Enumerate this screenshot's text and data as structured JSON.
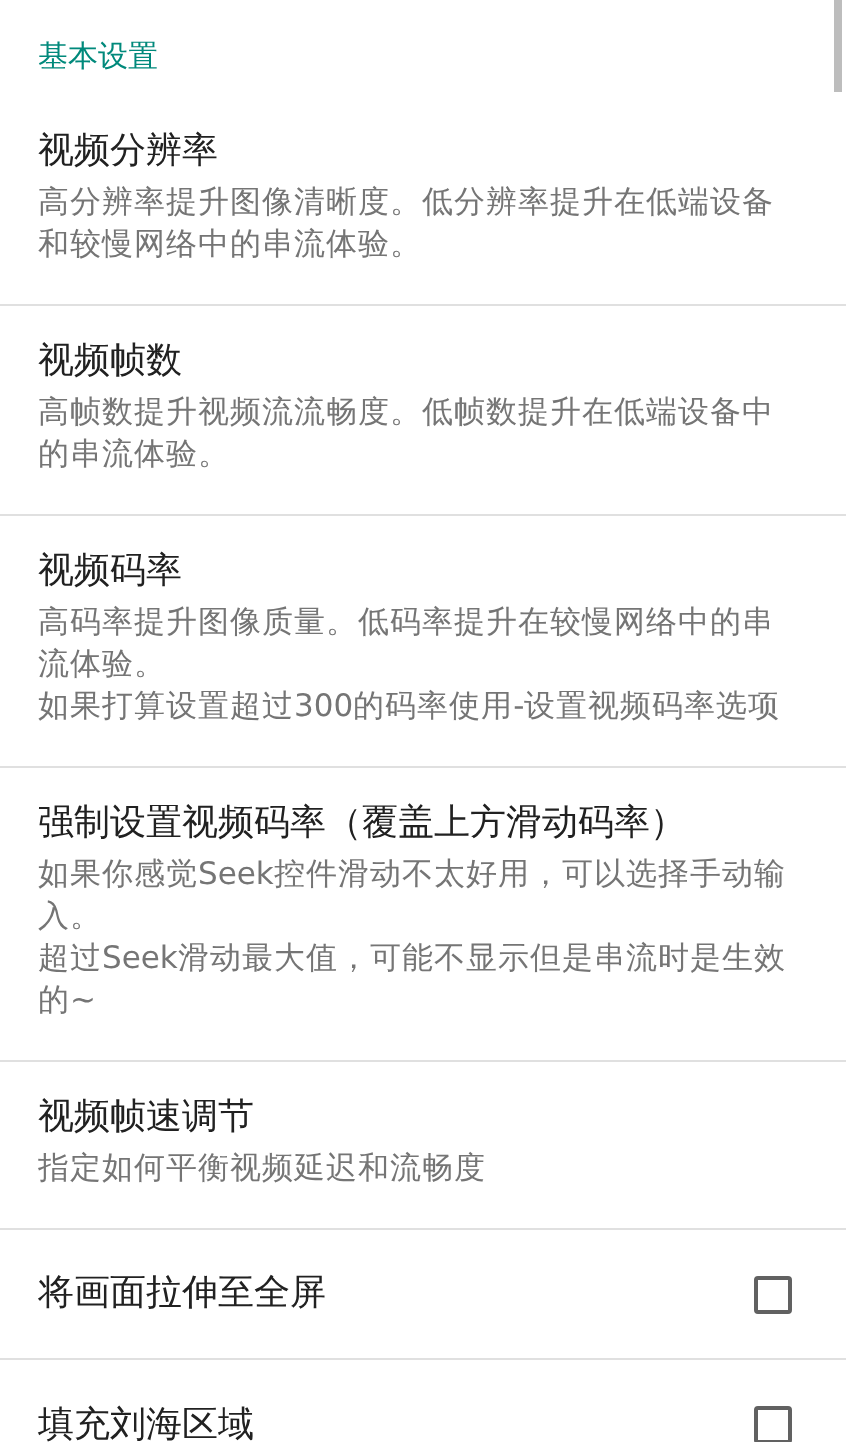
{
  "section_header": "基本设置",
  "items": [
    {
      "kind": "text",
      "title": "视频分辨率",
      "summary": [
        "高分辨率提升图像清晰度。低分辨率提升在低端设备和较慢网络中的串流体验。"
      ]
    },
    {
      "kind": "text",
      "title": "视频帧数",
      "summary": [
        "高帧数提升视频流流畅度。低帧数提升在低端设备中的串流体验。"
      ]
    },
    {
      "kind": "text",
      "title": "视频码率",
      "summary": [
        "高码率提升图像质量。低码率提升在较慢网络中的串流体验。",
        "如果打算设置超过300的码率使用-设置视频码率选项"
      ]
    },
    {
      "kind": "text",
      "title": "强制设置视频码率（覆盖上方滑动码率）",
      "summary": [
        "如果你感觉Seek控件滑动不太好用，可以选择手动输入。",
        "超过Seek滑动最大值，可能不显示但是串流时是生效的~"
      ]
    },
    {
      "kind": "text",
      "title": "视频帧速调节",
      "summary": [
        "指定如何平衡视频延迟和流畅度"
      ]
    },
    {
      "kind": "checkbox",
      "title": "将画面拉伸至全屏",
      "checked": false
    },
    {
      "kind": "checkbox",
      "title": "填充刘海区域",
      "checked": false
    }
  ]
}
